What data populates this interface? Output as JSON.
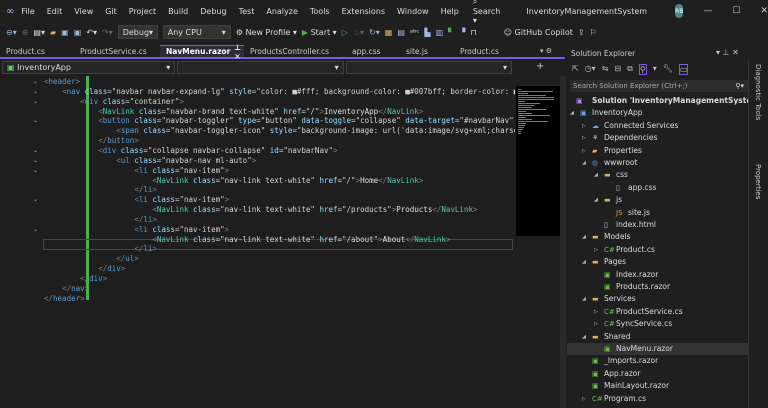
{
  "menu": {
    "items": [
      "File",
      "Edit",
      "View",
      "Git",
      "Project",
      "Build",
      "Debug",
      "Test",
      "Analyze",
      "Tools",
      "Extensions",
      "Window",
      "Help"
    ],
    "search": "Search",
    "title": "InventoryManagementSystem",
    "avatar": "RB"
  },
  "toolbar": {
    "config": "Debug",
    "platform": "Any CPU",
    "profile": "New Profile",
    "start": "Start",
    "copilot": "GitHub Copilot"
  },
  "tabs": [
    {
      "label": "Product.cs"
    },
    {
      "label": "ProductService.cs"
    },
    {
      "label": "NavMenu.razor",
      "active": true
    },
    {
      "label": "ProductsController.cs"
    },
    {
      "label": "app.css"
    },
    {
      "label": "site.js"
    },
    {
      "label": "Product.cs"
    }
  ],
  "editor_nav": {
    "project": "InventoryApp"
  },
  "code": [
    [
      [
        "p",
        "<"
      ],
      [
        "t",
        "header"
      ],
      [
        "p",
        ">"
      ]
    ],
    [
      [
        "x",
        "    "
      ],
      [
        "p",
        "<"
      ],
      [
        "t",
        "nav "
      ],
      [
        "a",
        "class"
      ],
      [
        "s",
        "=\"navbar navbar-expand-lg\" "
      ],
      [
        "a",
        "style"
      ],
      [
        "s",
        "=\"color: ■#fff; background-color: ■#007bff; border-color: ■"
      ]
    ],
    [
      [
        "x",
        "        "
      ],
      [
        "p",
        "<"
      ],
      [
        "t",
        "div "
      ],
      [
        "a",
        "class"
      ],
      [
        "s",
        "=\"container\""
      ],
      [
        "p",
        ">"
      ]
    ],
    [
      [
        "x",
        "            "
      ],
      [
        "p",
        "<"
      ],
      [
        "c",
        "NavLink "
      ],
      [
        "a",
        "class"
      ],
      [
        "s",
        "=\"navbar-brand text-white\" "
      ],
      [
        "a",
        "href"
      ],
      [
        "s",
        "=\"/\""
      ],
      [
        "p",
        ">"
      ],
      [
        "x",
        "InventoryApp"
      ],
      [
        "p",
        "</"
      ],
      [
        "c",
        "NavLink"
      ],
      [
        "p",
        ">"
      ]
    ],
    [
      [
        "x",
        "            "
      ],
      [
        "p",
        "<"
      ],
      [
        "t",
        "button "
      ],
      [
        "a",
        "class"
      ],
      [
        "s",
        "=\"navbar-toggler\" "
      ],
      [
        "a",
        "type"
      ],
      [
        "s",
        "=\"button\" "
      ],
      [
        "a",
        "data-toggle"
      ],
      [
        "s",
        "=\"collapse\" "
      ],
      [
        "a",
        "data-target"
      ],
      [
        "s",
        "=\"#navbarNav\" ar"
      ]
    ],
    [
      [
        "x",
        "                "
      ],
      [
        "p",
        "<"
      ],
      [
        "t",
        "span "
      ],
      [
        "a",
        "class"
      ],
      [
        "s",
        "=\"navbar-toggler-icon\" "
      ],
      [
        "a",
        "style"
      ],
      [
        "s",
        "=\"background-image: url('data:image/svg+xml;charset="
      ]
    ],
    [
      [
        "x",
        "            "
      ],
      [
        "p",
        "</"
      ],
      [
        "t",
        "button"
      ],
      [
        "p",
        ">"
      ]
    ],
    [
      [
        "x",
        "            "
      ],
      [
        "p",
        "<"
      ],
      [
        "t",
        "div "
      ],
      [
        "a",
        "class"
      ],
      [
        "s",
        "=\"collapse navbar-collapse\" "
      ],
      [
        "a",
        "id"
      ],
      [
        "s",
        "=\"navbarNav\""
      ],
      [
        "p",
        ">"
      ]
    ],
    [
      [
        "x",
        "                "
      ],
      [
        "p",
        "<"
      ],
      [
        "t",
        "ul "
      ],
      [
        "a",
        "class"
      ],
      [
        "s",
        "=\"navbar-nav ml-auto\""
      ],
      [
        "p",
        ">"
      ]
    ],
    [
      [
        "x",
        "                    "
      ],
      [
        "p",
        "<"
      ],
      [
        "t",
        "li "
      ],
      [
        "a",
        "class"
      ],
      [
        "s",
        "=\"nav-item\""
      ],
      [
        "p",
        ">"
      ]
    ],
    [
      [
        "x",
        "                        "
      ],
      [
        "p",
        "<"
      ],
      [
        "c",
        "NavLink "
      ],
      [
        "a",
        "class"
      ],
      [
        "s",
        "=\"nav-link text-white\" "
      ],
      [
        "a",
        "href"
      ],
      [
        "s",
        "=\"/\""
      ],
      [
        "p",
        ">"
      ],
      [
        "x",
        "Home"
      ],
      [
        "p",
        "</"
      ],
      [
        "c",
        "NavLink"
      ],
      [
        "p",
        ">"
      ]
    ],
    [
      [
        "x",
        "                    "
      ],
      [
        "p",
        "</"
      ],
      [
        "t",
        "li"
      ],
      [
        "p",
        ">"
      ]
    ],
    [
      [
        "x",
        "                    "
      ],
      [
        "p",
        "<"
      ],
      [
        "t",
        "li "
      ],
      [
        "a",
        "class"
      ],
      [
        "s",
        "=\"nav-item\""
      ],
      [
        "p",
        ">"
      ]
    ],
    [
      [
        "x",
        "                        "
      ],
      [
        "p",
        "<"
      ],
      [
        "c",
        "NavLink "
      ],
      [
        "a",
        "class"
      ],
      [
        "s",
        "=\"nav-link text-white\" "
      ],
      [
        "a",
        "href"
      ],
      [
        "s",
        "=\"/products\""
      ],
      [
        "p",
        ">"
      ],
      [
        "x",
        "Products"
      ],
      [
        "p",
        "</"
      ],
      [
        "c",
        "NavLink"
      ],
      [
        "p",
        ">"
      ]
    ],
    [
      [
        "x",
        "                    "
      ],
      [
        "p",
        "</"
      ],
      [
        "t",
        "li"
      ],
      [
        "p",
        ">"
      ]
    ],
    [
      [
        "x",
        "                    "
      ],
      [
        "p",
        "<"
      ],
      [
        "t",
        "li "
      ],
      [
        "a",
        "class"
      ],
      [
        "s",
        "=\"nav-item\""
      ],
      [
        "p",
        ">"
      ]
    ],
    [
      [
        "x",
        "                        "
      ],
      [
        "p",
        "<"
      ],
      [
        "c",
        "NavLink "
      ],
      [
        "a",
        "class"
      ],
      [
        "s",
        "=\"nav-link text-white\" "
      ],
      [
        "a",
        "href"
      ],
      [
        "s",
        "=\"/about\""
      ],
      [
        "p",
        ">"
      ],
      [
        "x",
        "About"
      ],
      [
        "p",
        "</"
      ],
      [
        "c",
        "NavLink"
      ],
      [
        "p",
        ">"
      ]
    ],
    [
      [
        "x",
        "                    "
      ],
      [
        "p",
        "</"
      ],
      [
        "t",
        "li"
      ],
      [
        "p",
        ">"
      ]
    ],
    [
      [
        "x",
        "                "
      ],
      [
        "p",
        "</"
      ],
      [
        "t",
        "ul"
      ],
      [
        "p",
        ">"
      ]
    ],
    [
      [
        "x",
        "            "
      ],
      [
        "p",
        "</"
      ],
      [
        "t",
        "div"
      ],
      [
        "p",
        ">"
      ]
    ],
    [
      [
        "x",
        "        "
      ],
      [
        "p",
        "</"
      ],
      [
        "t",
        "div"
      ],
      [
        "p",
        ">"
      ]
    ],
    [
      [
        "x",
        "    "
      ],
      [
        "p",
        "</"
      ],
      [
        "t",
        "nav"
      ],
      [
        "p",
        ">"
      ]
    ],
    [
      [
        "p",
        "</"
      ],
      [
        "t",
        "header"
      ],
      [
        "p",
        ">"
      ]
    ]
  ],
  "folds": [
    0,
    1,
    2,
    4,
    7,
    8,
    9,
    12,
    15
  ],
  "solution_explorer": {
    "title": "Solution Explorer",
    "search_placeholder": "Search Solution Explorer (Ctrl+;)",
    "tree": [
      {
        "label": "Solution 'InventoryManagementSystem' (",
        "level": 0,
        "icon": "solution-icon"
      },
      {
        "label": "InventoryApp",
        "level": 0,
        "arrow": "expanded",
        "icon": "project-icon"
      },
      {
        "label": "Connected Services",
        "level": 1,
        "arrow": "collapsed",
        "icon": "connected-services-icon"
      },
      {
        "label": "Dependencies",
        "level": 1,
        "arrow": "collapsed",
        "icon": "dependencies-icon"
      },
      {
        "label": "Properties",
        "level": 1,
        "arrow": "collapsed",
        "icon": "properties-icon"
      },
      {
        "label": "wwwroot",
        "level": 1,
        "arrow": "expanded",
        "icon": "globe-icon"
      },
      {
        "label": "css",
        "level": 2,
        "arrow": "expanded",
        "icon": "folder-icon"
      },
      {
        "label": "app.css",
        "level": 3,
        "icon": "css-file-icon"
      },
      {
        "label": "js",
        "level": 2,
        "arrow": "expanded",
        "icon": "folder-icon"
      },
      {
        "label": "site.js",
        "level": 3,
        "icon": "js-file-icon"
      },
      {
        "label": "index.html",
        "level": 2,
        "icon": "html-file-icon"
      },
      {
        "label": "Models",
        "level": 1,
        "arrow": "expanded",
        "icon": "folder-icon"
      },
      {
        "label": "Product.cs",
        "level": 2,
        "arrow": "collapsed",
        "icon": "csharp-file-icon"
      },
      {
        "label": "Pages",
        "level": 1,
        "arrow": "expanded",
        "icon": "folder-icon"
      },
      {
        "label": "Index.razor",
        "level": 2,
        "icon": "razor-file-icon"
      },
      {
        "label": "Products.razor",
        "level": 2,
        "icon": "razor-file-icon"
      },
      {
        "label": "Services",
        "level": 1,
        "arrow": "expanded",
        "icon": "folder-icon"
      },
      {
        "label": "ProductService.cs",
        "level": 2,
        "arrow": "collapsed",
        "icon": "csharp-file-icon"
      },
      {
        "label": "SyncService.cs",
        "level": 2,
        "arrow": "collapsed",
        "icon": "csharp-file-icon"
      },
      {
        "label": "Shared",
        "level": 1,
        "arrow": "expanded",
        "icon": "folder-icon"
      },
      {
        "label": "NavMenu.razor",
        "level": 2,
        "icon": "razor-file-icon",
        "selected": true
      },
      {
        "label": "_Imports.razor",
        "level": 1,
        "icon": "razor-file-icon"
      },
      {
        "label": "App.razor",
        "level": 1,
        "icon": "razor-file-icon"
      },
      {
        "label": "MainLayout.razor",
        "level": 1,
        "icon": "razor-file-icon"
      },
      {
        "label": "Program.cs",
        "level": 1,
        "arrow": "collapsed",
        "icon": "csharp-file-icon"
      }
    ]
  },
  "side_tabs": [
    "Diagnostic Tools",
    "Properties"
  ],
  "colors": {
    "accent": "#7a5ae0",
    "modified_bar": "#4caf50"
  }
}
